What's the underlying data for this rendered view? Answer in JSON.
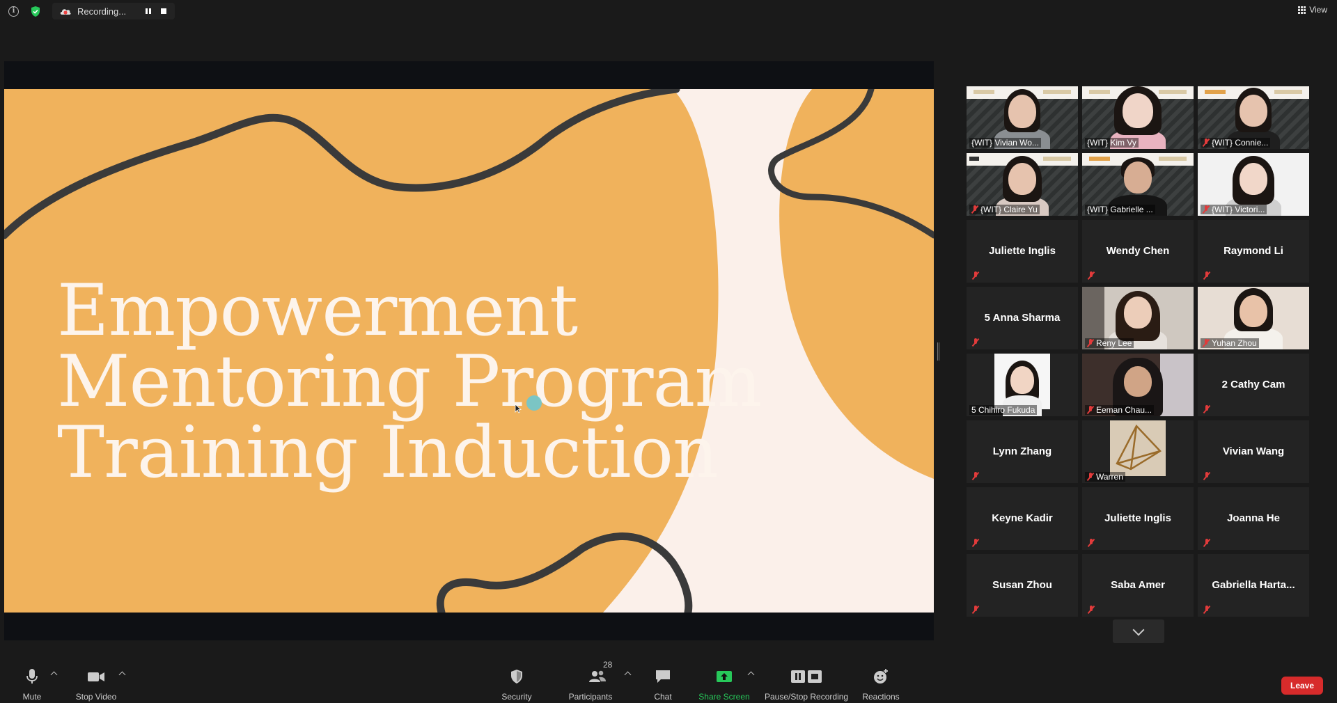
{
  "topbar": {
    "recording_label": "Recording...",
    "view_label": "View"
  },
  "slide": {
    "title_lines": [
      "Empowerment",
      "Mentoring Program",
      "Training Induction"
    ],
    "colors": {
      "orange": "#f0b25c",
      "cream": "#fbf0ea",
      "ink": "#3a3a3a"
    }
  },
  "gallery": {
    "tiles": [
      {
        "name": "{WIT} Vivian Wo...",
        "video": true,
        "muted": false
      },
      {
        "name": "{WIT} Kim Vy",
        "video": true,
        "muted": false
      },
      {
        "name": "{WIT} Connie...",
        "video": true,
        "muted": true
      },
      {
        "name": "{WIT} Claire Yu",
        "video": true,
        "muted": true
      },
      {
        "name": "{WIT} Gabrielle ...",
        "video": true,
        "muted": false,
        "active_speaker": true
      },
      {
        "name": "{WIT} Victori...",
        "video": true,
        "muted": true
      },
      {
        "name": "Juliette Inglis",
        "video": false,
        "muted": true
      },
      {
        "name": "Wendy Chen",
        "video": false,
        "muted": true
      },
      {
        "name": "Raymond Li",
        "video": false,
        "muted": true
      },
      {
        "name": "5 Anna Sharma",
        "video": false,
        "muted": true
      },
      {
        "name": "Reny Lee",
        "video": true,
        "muted": true
      },
      {
        "name": "Yuhan Zhou",
        "video": true,
        "muted": true
      },
      {
        "name": "5 Chihiro Fukuda",
        "video": true,
        "muted": false
      },
      {
        "name": "Eeman Chau...",
        "video": true,
        "muted": true
      },
      {
        "name": "2 Cathy Cam",
        "video": false,
        "muted": true
      },
      {
        "name": "Lynn Zhang",
        "video": false,
        "muted": true
      },
      {
        "name": "Warren",
        "video": true,
        "muted": true
      },
      {
        "name": "Vivian Wang",
        "video": false,
        "muted": true
      },
      {
        "name": "Keyne Kadir",
        "video": false,
        "muted": true
      },
      {
        "name": "Juliette Inglis",
        "video": false,
        "muted": true
      },
      {
        "name": "Joanna He",
        "video": false,
        "muted": true
      },
      {
        "name": "Susan Zhou",
        "video": false,
        "muted": true
      },
      {
        "name": "Saba Amer",
        "video": false,
        "muted": true
      },
      {
        "name": "Gabriella  Harta...",
        "video": false,
        "muted": true
      }
    ]
  },
  "toolbar": {
    "mute": "Mute",
    "stop_video": "Stop Video",
    "security": "Security",
    "participants": "Participants",
    "participants_count": "28",
    "chat": "Chat",
    "share_screen": "Share Screen",
    "pause_stop_recording": "Pause/Stop Recording",
    "reactions": "Reactions",
    "leave": "Leave"
  }
}
